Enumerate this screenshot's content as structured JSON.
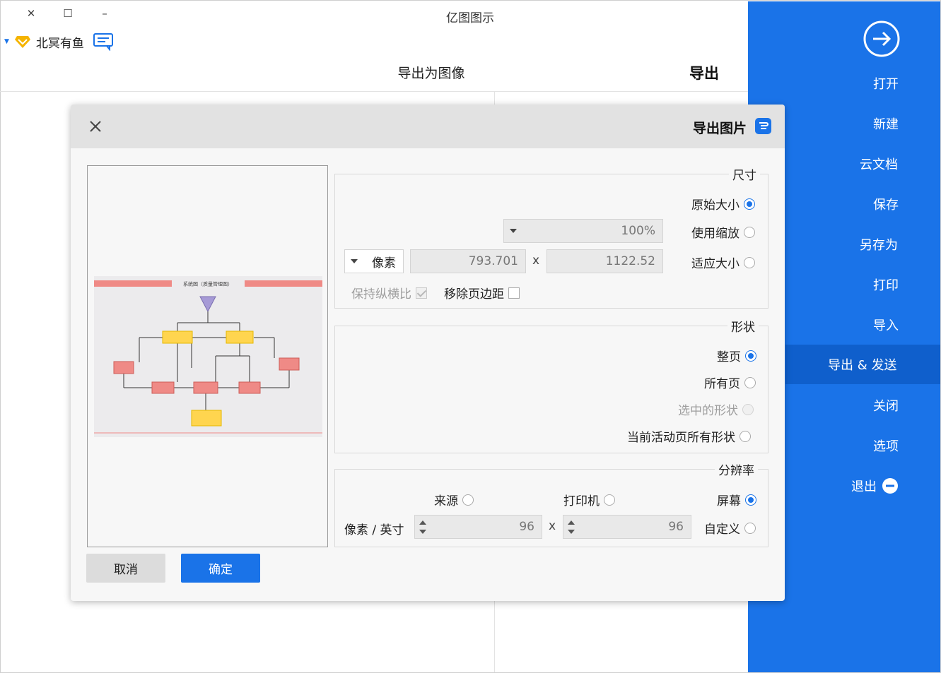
{
  "window": {
    "title": "亿图图示",
    "controls": [
      "✕",
      "☐",
      "–"
    ]
  },
  "user": {
    "name": "北冥有鱼"
  },
  "header": {
    "export_image_title": "导出为图像",
    "export_title": "导出"
  },
  "sidebar": {
    "items": [
      {
        "label": "打开"
      },
      {
        "label": "新建"
      },
      {
        "label": "云文档"
      },
      {
        "label": "保存"
      },
      {
        "label": "另存为"
      },
      {
        "label": "打印"
      },
      {
        "label": "导入"
      },
      {
        "label": "导出 & 发送"
      },
      {
        "label": "关闭"
      },
      {
        "label": "选项"
      },
      {
        "label": "退出"
      }
    ],
    "active_index": 7,
    "accent": "#1a73e8"
  },
  "dialog": {
    "title": "导出图片",
    "size_group": {
      "title": "尺寸",
      "original_size": "原始大小",
      "use_zoom": "使用缩放",
      "zoom_value": "100%",
      "fit_size": "适应大小",
      "width_value": "1122.52",
      "height_value": "793.701",
      "times": "x",
      "unit": "像素",
      "remove_margin": "移除页边距",
      "keep_ratio": "保持纵横比"
    },
    "shape_group": {
      "title": "形状",
      "whole_page": "整页",
      "all_pages": "所有页",
      "selected_shapes": "选中的形状",
      "all_shapes_current": "当前活动页所有形状"
    },
    "resolution_group": {
      "title": "分辨率",
      "screen": "屏幕",
      "printer": "打印机",
      "source": "来源",
      "custom": "自定义",
      "dpi_x": "96",
      "dpi_y": "96",
      "times": "x",
      "unit": "像素 / 英寸"
    },
    "ok_label": "确定",
    "cancel_label": "取消"
  },
  "preview": {
    "diagram_title": "系统图（质量管理图）"
  }
}
